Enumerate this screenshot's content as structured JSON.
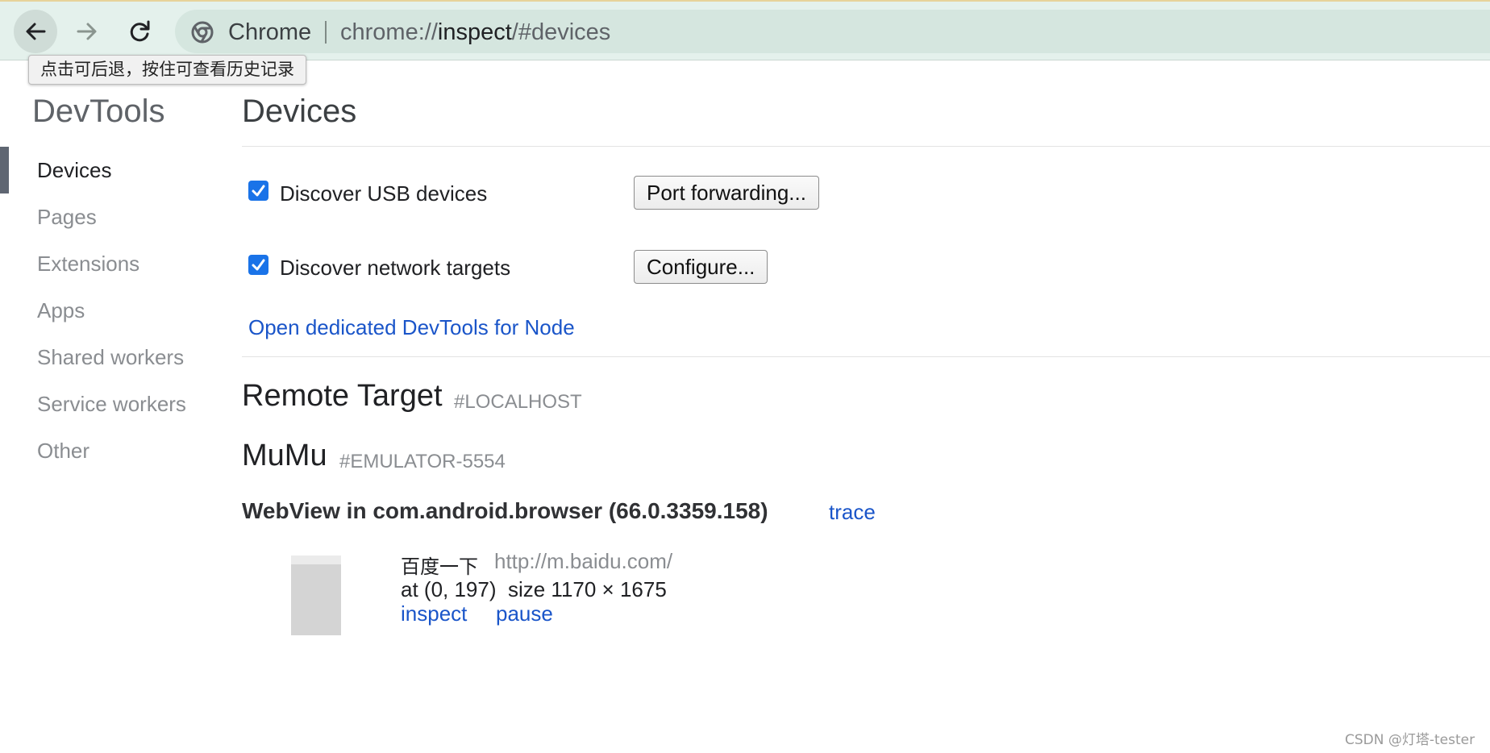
{
  "browser": {
    "site_name": "Chrome",
    "url_scheme": "chrome://",
    "url_host": "inspect",
    "url_path": "/#devices",
    "back_tooltip": "点击可后退，按住可查看历史记录"
  },
  "sidebar": {
    "title": "DevTools",
    "items": [
      {
        "label": "Devices",
        "active": true
      },
      {
        "label": "Pages",
        "active": false
      },
      {
        "label": "Extensions",
        "active": false
      },
      {
        "label": "Apps",
        "active": false
      },
      {
        "label": "Shared workers",
        "active": false
      },
      {
        "label": "Service workers",
        "active": false
      },
      {
        "label": "Other",
        "active": false
      }
    ]
  },
  "main": {
    "title": "Devices",
    "options": {
      "usb_label": "Discover USB devices",
      "usb_checked": true,
      "port_forwarding_button": "Port forwarding...",
      "network_label": "Discover network targets",
      "network_checked": true,
      "configure_button": "Configure...",
      "node_link": "Open dedicated DevTools for Node"
    },
    "remote_target": {
      "title": "Remote Target",
      "subtitle": "#LOCALHOST"
    },
    "device": {
      "name": "MuMu",
      "id": "#EMULATOR-5554",
      "browser": "WebView in com.android.browser (66.0.3359.158)",
      "trace_link": "trace",
      "target": {
        "name": "百度一下",
        "url": "http://m.baidu.com/",
        "position": "at (0, 197)  size 1170 × 1675",
        "inspect_link": "inspect",
        "pause_link": "pause"
      }
    }
  },
  "watermark": "CSDN @灯塔-tester",
  "colors": {
    "accent": "#1a73e8",
    "link": "#1a55c9",
    "toolbar_bg": "#e4f1ec",
    "omnibox_bg": "#d5e6df"
  },
  "icons": {
    "back": "arrow-left-icon",
    "forward": "arrow-right-icon",
    "reload": "reload-icon",
    "site": "chrome-logo-icon",
    "checkbox": "checkmark-icon"
  }
}
